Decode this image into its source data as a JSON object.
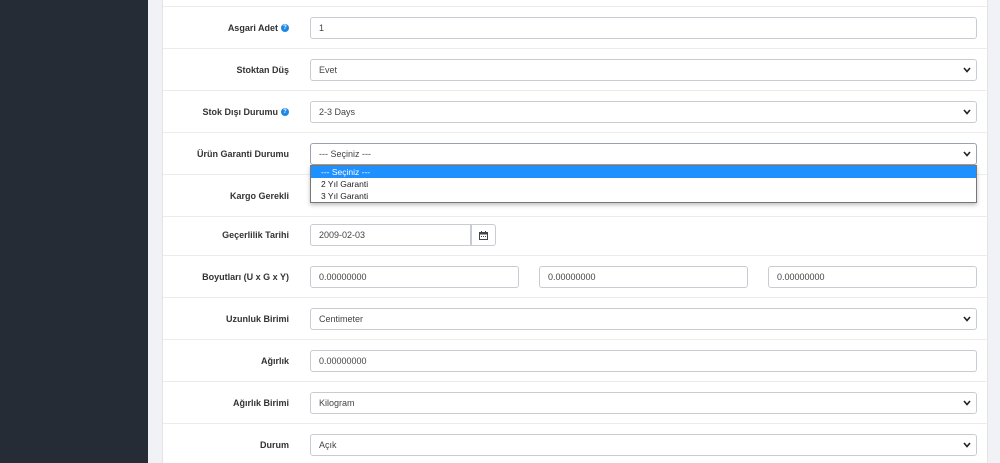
{
  "colors": {
    "sidebar": "#262c36",
    "accent": "#1e90ff",
    "help": "#1e88e5"
  },
  "fields": {
    "min_qty": {
      "label": "Asgari Adet",
      "value": "1",
      "help_icon": "question-circle-icon"
    },
    "stock_subtract": {
      "label": "Stoktan Düş",
      "value": "Evet"
    },
    "out_of_stock": {
      "label": "Stok Dışı Durumu",
      "value": "2-3 Days",
      "help_icon": "question-circle-icon"
    },
    "warranty": {
      "label": "Ürün Garanti Durumu",
      "value": "--- Seçiniz ---",
      "options": [
        "--- Seçiniz ---",
        "2 Yıl Garanti",
        "3 Yıl Garanti"
      ],
      "selected_index": 0
    },
    "shipping": {
      "label": "Kargo Gerekli"
    },
    "date_available": {
      "label": "Geçerlilik Tarihi",
      "value": "2009-02-03",
      "icon": "calendar-icon"
    },
    "dimensions": {
      "label": "Boyutları (U x G x Y)",
      "length": "0.00000000",
      "width": "0.00000000",
      "height": "0.00000000"
    },
    "length_class": {
      "label": "Uzunluk Birimi",
      "value": "Centimeter"
    },
    "weight": {
      "label": "Ağırlık",
      "value": "0.00000000"
    },
    "weight_class": {
      "label": "Ağırlık Birimi",
      "value": "Kilogram"
    },
    "status": {
      "label": "Durum",
      "value": "Açık"
    }
  }
}
